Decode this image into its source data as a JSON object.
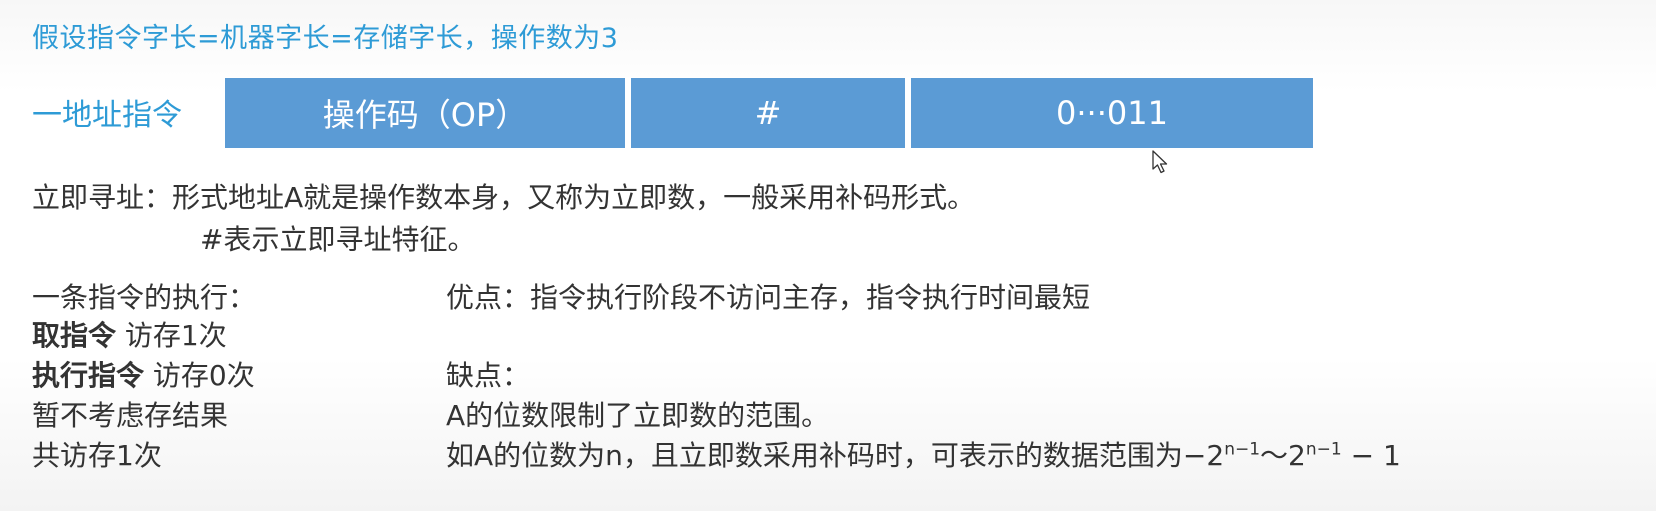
{
  "title": "假设指令字长=机器字长=存储字长，操作数为3",
  "instruction": {
    "label": "一地址指令",
    "fields": {
      "op": "操作码（OP）",
      "mode": "#",
      "address": "0···011"
    }
  },
  "definition": {
    "line1": "立即寻址：形式地址A就是操作数本身，又称为立即数，一般采用补码形式。",
    "line2": "#表示立即寻址特征。"
  },
  "execution": {
    "heading": "一条指令的执行：",
    "fetch_bold": "取指令",
    "fetch_rest": " 访存1次",
    "exec_bold": "执行指令",
    "exec_rest": " 访存0次",
    "no_result": "暂不考虑存结果",
    "total": "共访存1次"
  },
  "pros_cons": {
    "advantage": "优点：指令执行阶段不访问主存，指令执行时间最短",
    "disadvantage": "缺点：",
    "limit": "A的位数限制了立即数的范围。",
    "range_text": "如A的位数为n，且立即数采用补码时，可表示的数据范围为",
    "range_minus": "−2",
    "range_exp1": "n−1",
    "range_tilde": "～2",
    "range_exp2": "n−1",
    "range_end": " − 1"
  },
  "colors": {
    "accent": "#2e9bd6",
    "field_fill": "#5b9bd5"
  }
}
